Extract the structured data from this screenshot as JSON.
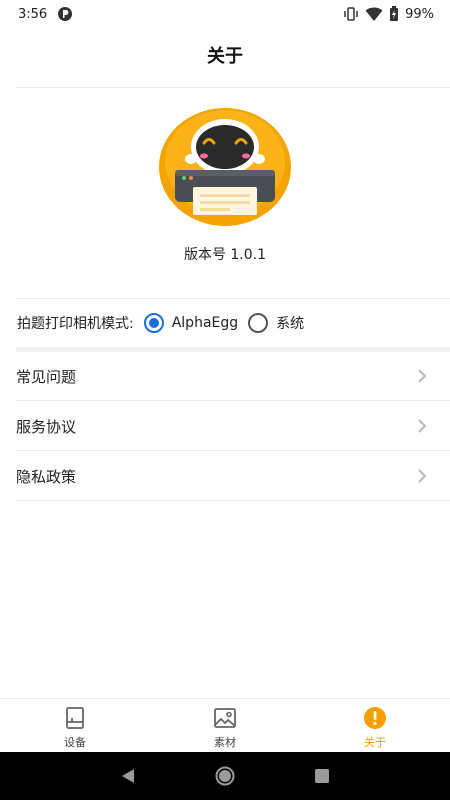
{
  "status_bar": {
    "time": "3:56",
    "battery": "99%"
  },
  "header": {
    "title": "关于"
  },
  "about": {
    "version": "版本号 1.0.1"
  },
  "print_mode": {
    "label": "拍题打印相机模式:",
    "options": [
      {
        "label": "AlphaEgg",
        "selected": true
      },
      {
        "label": "系统",
        "selected": false
      }
    ]
  },
  "menu": {
    "items": [
      {
        "label": "常见问题"
      },
      {
        "label": "服务协议"
      },
      {
        "label": "隐私政策"
      }
    ]
  },
  "bottom_nav": {
    "tabs": [
      {
        "label": "设备",
        "icon": "device-icon",
        "active": false
      },
      {
        "label": "素材",
        "icon": "image-icon",
        "active": false
      },
      {
        "label": "关于",
        "icon": "info-icon",
        "active": true
      }
    ]
  },
  "colors": {
    "accent": "#f5a000",
    "radio_selected": "#1c6fd6"
  }
}
